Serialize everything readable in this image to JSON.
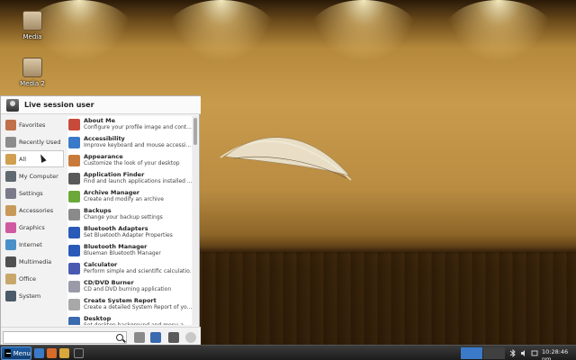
{
  "desktop": {
    "icons": [
      {
        "label": "Media"
      },
      {
        "label": "Media 2"
      }
    ]
  },
  "menu": {
    "user_name": "Live session user",
    "categories": [
      {
        "label": "Favorites",
        "icon": "star-folder-icon",
        "color": "#c0704a"
      },
      {
        "label": "Recently Used",
        "icon": "clock-icon",
        "color": "#8c8c8c"
      },
      {
        "label": "All",
        "icon": "all-apps-icon",
        "color": "#d0a050"
      },
      {
        "label": "My Computer",
        "icon": "computer-icon",
        "color": "#606870"
      },
      {
        "label": "Settings",
        "icon": "settings-icon",
        "color": "#7a7a8a"
      },
      {
        "label": "Accessories",
        "icon": "accessories-icon",
        "color": "#c89a5a"
      },
      {
        "label": "Graphics",
        "icon": "graphics-icon",
        "color": "#d05aa0"
      },
      {
        "label": "Internet",
        "icon": "internet-icon",
        "color": "#4a90c8"
      },
      {
        "label": "Multimedia",
        "icon": "multimedia-icon",
        "color": "#505050"
      },
      {
        "label": "Office",
        "icon": "office-icon",
        "color": "#c8a86a"
      },
      {
        "label": "System",
        "icon": "system-icon",
        "color": "#4a5a6a"
      }
    ],
    "apps": [
      {
        "name": "About Me",
        "desc": "Configure your profile image and cont...",
        "icon": "about-me-icon",
        "color": "#c84a3a"
      },
      {
        "name": "Accessibility",
        "desc": "Improve keyboard and mouse accessi...",
        "icon": "accessibility-icon",
        "color": "#3a7ac8"
      },
      {
        "name": "Appearance",
        "desc": "Customize the look of your desktop",
        "icon": "appearance-icon",
        "color": "#c87a3a"
      },
      {
        "name": "Application Finder",
        "desc": "Find and launch applications installed ...",
        "icon": "app-finder-icon",
        "color": "#5a5a5a"
      },
      {
        "name": "Archive Manager",
        "desc": "Create and modify an archive",
        "icon": "archive-icon",
        "color": "#6aa83a"
      },
      {
        "name": "Backups",
        "desc": "Change your backup settings",
        "icon": "backups-icon",
        "color": "#8a8a8a"
      },
      {
        "name": "Bluetooth Adapters",
        "desc": "Set Bluetooth Adapter Properties",
        "icon": "bluetooth-icon",
        "color": "#2a5ab8"
      },
      {
        "name": "Bluetooth Manager",
        "desc": "Blueman Bluetooth Manager",
        "icon": "bluetooth-icon",
        "color": "#2a5ab8"
      },
      {
        "name": "Calculator",
        "desc": "Perform simple and scientific calculatio...",
        "icon": "calculator-icon",
        "color": "#4a5ab0"
      },
      {
        "name": "CD/DVD Burner",
        "desc": "CD and DVD burning application",
        "icon": "disc-icon",
        "color": "#9a9aa8"
      },
      {
        "name": "Create System Report",
        "desc": "Create a detailed System Report of yo...",
        "icon": "report-icon",
        "color": "#a8a8a8"
      },
      {
        "name": "Desktop",
        "desc": "Set desktop background and menu a...",
        "icon": "desktop-icon",
        "color": "#3a6ab0"
      }
    ],
    "search": {
      "value": "",
      "placeholder": ""
    },
    "footer_buttons": [
      {
        "icon": "package-icon",
        "color": "#8a8a8a"
      },
      {
        "icon": "display-settings-icon",
        "color": "#3a6ab0"
      },
      {
        "icon": "lock-icon",
        "color": "#5a5a5a"
      },
      {
        "icon": "logout-icon",
        "color": "#c8c8c8"
      }
    ]
  },
  "taskbar": {
    "start_label": "Menu",
    "clock": "10:28:46 pm",
    "launchers": [
      {
        "icon": "files-icon",
        "color": "#3a7ac8"
      },
      {
        "icon": "firefox-icon",
        "color": "#d86a2a"
      },
      {
        "icon": "folder-icon",
        "color": "#d8a83a"
      },
      {
        "icon": "terminal-icon",
        "color": "#2a2a2a"
      }
    ],
    "workspace_colors": [
      "#3a7ac8",
      "#404040",
      "#404040",
      "#404040"
    ]
  }
}
